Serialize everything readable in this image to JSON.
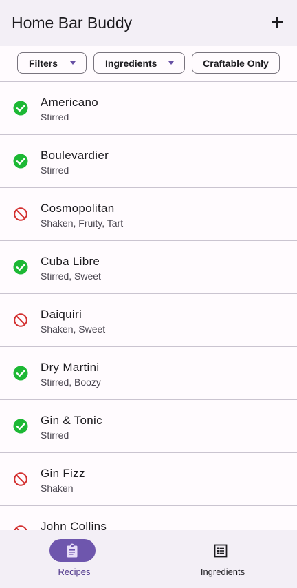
{
  "app_title": "Home Bar Buddy",
  "add_icon": "plus-icon",
  "filters": {
    "filters_label": "Filters",
    "ingredients_label": "Ingredients",
    "craftable_label": "Craftable Only"
  },
  "colors": {
    "craftable": "#1db835",
    "not_craftable": "#d32f2f",
    "accent": "#6e56ad"
  },
  "recipes": [
    {
      "name": "Americano",
      "tags": "Stirred",
      "craftable": true
    },
    {
      "name": "Boulevardier",
      "tags": "Stirred",
      "craftable": true
    },
    {
      "name": "Cosmopolitan",
      "tags": "Shaken, Fruity, Tart",
      "craftable": false
    },
    {
      "name": "Cuba Libre",
      "tags": "Stirred, Sweet",
      "craftable": true
    },
    {
      "name": "Daiquiri",
      "tags": "Shaken, Sweet",
      "craftable": false
    },
    {
      "name": "Dry Martini",
      "tags": "Stirred, Boozy",
      "craftable": true
    },
    {
      "name": "Gin & Tonic",
      "tags": "Stirred",
      "craftable": true
    },
    {
      "name": "Gin Fizz",
      "tags": "Shaken",
      "craftable": false
    },
    {
      "name": "John Collins",
      "tags": "",
      "craftable": false
    }
  ],
  "bottom_nav": {
    "recipes_label": "Recipes",
    "ingredients_label": "Ingredients"
  }
}
